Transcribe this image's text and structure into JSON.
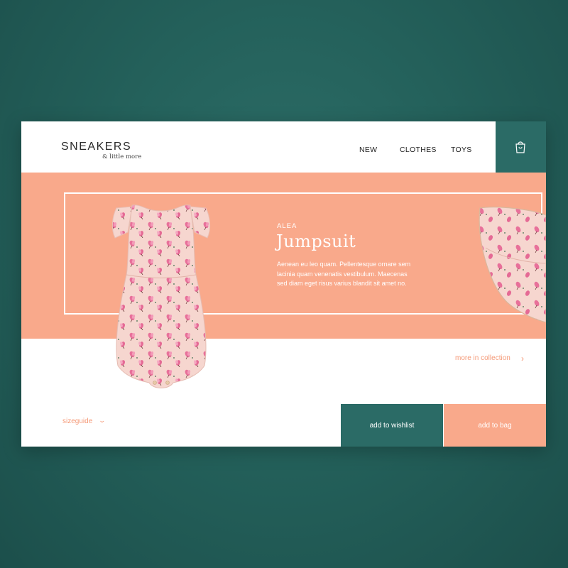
{
  "brand": {
    "name": "SNEAKERS",
    "tagline": "& little more"
  },
  "nav": {
    "items": [
      "NEW",
      "CLOTHES",
      "TOYS"
    ]
  },
  "header": {
    "bag_icon": "shopping-bag-icon"
  },
  "product": {
    "label": "ALEA",
    "title": "Jumpsuit",
    "description": "Aenean eu leo quam. Pellentesque ornare sem lacinia quam venenatis vestibulum. Maecenas sed diam eget risus varius blandit sit amet no."
  },
  "collection": {
    "more_label": "more in collection",
    "chevron": "›"
  },
  "sizeguide": {
    "label": "sizeguide",
    "chevron": "⌄"
  },
  "actions": {
    "wishlist_label": "add to wishlist",
    "bag_label": "add to bag"
  },
  "colors": {
    "accent": "#f9a98b",
    "primary": "#2b6b66",
    "link": "#f59a78",
    "background": "#245e59"
  }
}
